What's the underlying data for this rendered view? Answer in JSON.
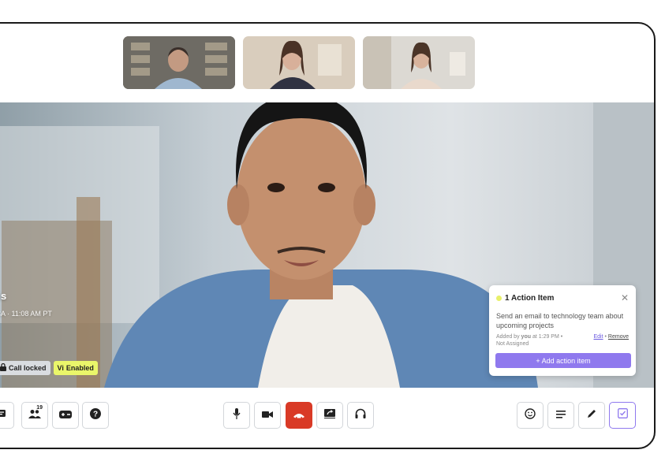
{
  "participants": [
    {
      "name": "participant-1"
    },
    {
      "name": "participant-2"
    },
    {
      "name": "participant-3"
    }
  ],
  "speaker": {
    "name_fragment": "arris",
    "company_fragment": "c.",
    "location_time": "co, CA · 11:08 AM PT"
  },
  "badges": {
    "recording": "ng",
    "lock": "Call locked",
    "vi_mark": "Vi",
    "vi_label": "Enabled"
  },
  "action_items": {
    "title": "1 Action Item",
    "item_text": "Send an email to technology team about upcoming projects",
    "added_prefix": "Added by",
    "added_by": "you",
    "added_time": "at 1:29 PM •",
    "assignee": "Not Assigned",
    "edit_label": "Edit",
    "separator": "•",
    "remove_label": "Remove",
    "add_label": "+ Add action item"
  },
  "toolbar": {
    "participants_count": "19"
  },
  "colors": {
    "accent": "#8f79ee",
    "end_call": "#d93a26",
    "vi_badge": "#eaf66a",
    "recording_badge": "#f6b6d8"
  }
}
